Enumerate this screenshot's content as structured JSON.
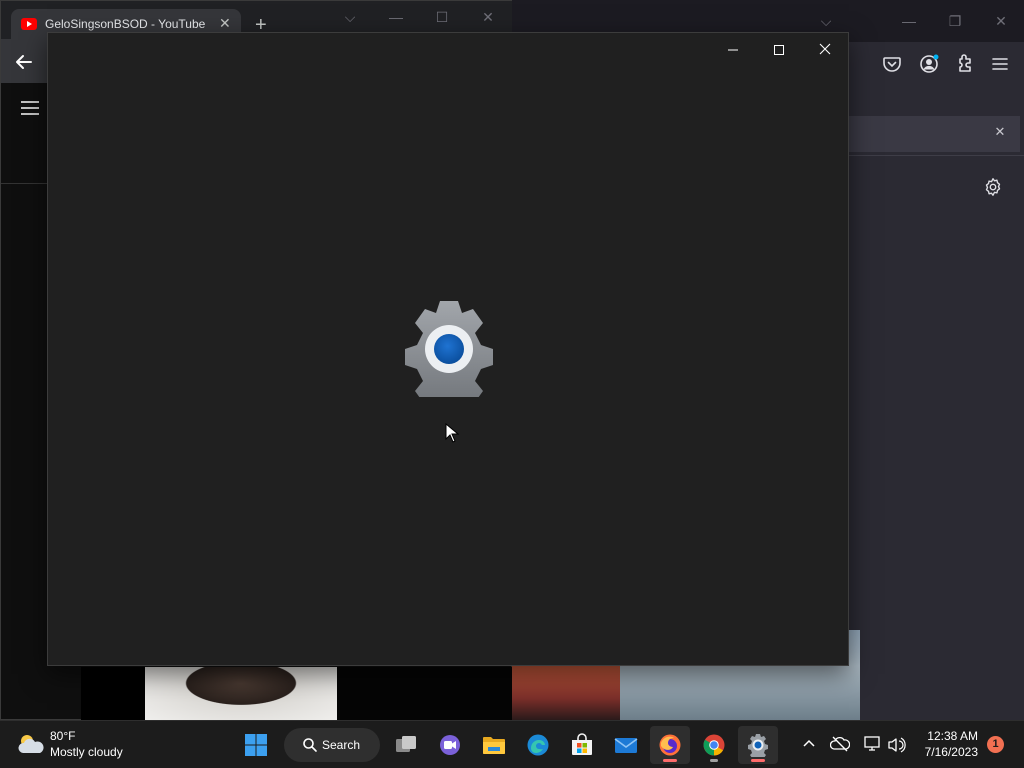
{
  "firefox_window": {
    "controls": {
      "tabs_dropdown": "⌵",
      "minimize": "—",
      "restore": "❐",
      "close": "✕"
    },
    "toolbar_icons": [
      "pocket-icon",
      "account-icon",
      "extensions-icon",
      "menu-icon"
    ],
    "notification_close": "✕",
    "settings_icon": "gear-icon"
  },
  "chrome_window": {
    "tab": {
      "title": "GeloSingsonBSOD - YouTube",
      "close": "✕"
    },
    "new_tab": "+",
    "controls": {
      "tabs_dropdown": "⌵",
      "minimize": "—",
      "maximize": "☐",
      "close": "✕"
    }
  },
  "settings_window": {
    "controls": [
      "minimize",
      "maximize",
      "close"
    ],
    "splash_icon": "settings-gear-icon"
  },
  "taskbar": {
    "weather": {
      "temp": "80°F",
      "desc": "Mostly cloudy"
    },
    "search_label": "Search",
    "apps": [
      "start",
      "task-view",
      "teams-chat",
      "file-explorer",
      "edge",
      "microsoft-store",
      "mail",
      "firefox",
      "chrome",
      "settings"
    ],
    "clock": {
      "time": "12:38 AM",
      "date": "7/16/2023"
    },
    "notification_count": "1"
  },
  "colors": {
    "settings_bg": "#202020",
    "taskbar_bg": "#1c1c1c",
    "accent_blue": "#0f62b8",
    "badge": "#f27052"
  }
}
